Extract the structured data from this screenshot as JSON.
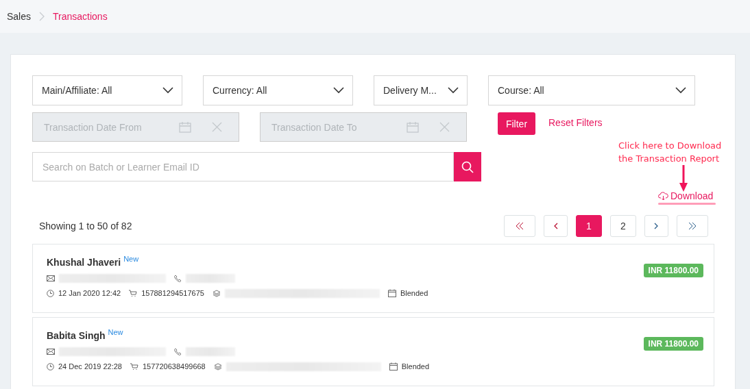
{
  "breadcrumb": [
    {
      "label": "Sales",
      "current": false
    },
    {
      "label": "Transactions",
      "current": true
    }
  ],
  "filters": {
    "selects": [
      {
        "label": "Main/Affiliate: All"
      },
      {
        "label": "Currency: All"
      },
      {
        "label": "Delivery M..."
      },
      {
        "label": "Course: All"
      }
    ],
    "date_fields": [
      {
        "placeholder": "Transaction Date From",
        "disabled": true
      },
      {
        "placeholder": "Transaction Date To",
        "disabled": true
      }
    ],
    "filter_button": "Filter",
    "reset_link": "Reset Filters",
    "search": {
      "placeholder": "Search on Batch or Learner Email ID"
    }
  },
  "annotation": "Click here to Download the Transaction Report",
  "download_link": "Download",
  "summary": "Showing 1 to 50 of 82",
  "pagination": [
    {
      "kind": "first",
      "selected": false
    },
    {
      "kind": "prev",
      "selected": false
    },
    {
      "kind": "page",
      "label": "1",
      "selected": true
    },
    {
      "kind": "page",
      "label": "2",
      "selected": false
    },
    {
      "kind": "next",
      "selected": false
    },
    {
      "kind": "last",
      "selected": false
    }
  ],
  "transactions": [
    {
      "name": "Khushal Jhaveri",
      "badge": "New",
      "date": "12 Jan 2020 12:42",
      "order_id": "157881294517675",
      "mode": "Blended",
      "amount": "INR 11800.00"
    },
    {
      "name": "Babita Singh",
      "badge": "New",
      "date": "24 Dec 2019 22:28",
      "order_id": "157720638499668",
      "mode": "Blended",
      "amount": "INR 11800.00"
    }
  ]
}
